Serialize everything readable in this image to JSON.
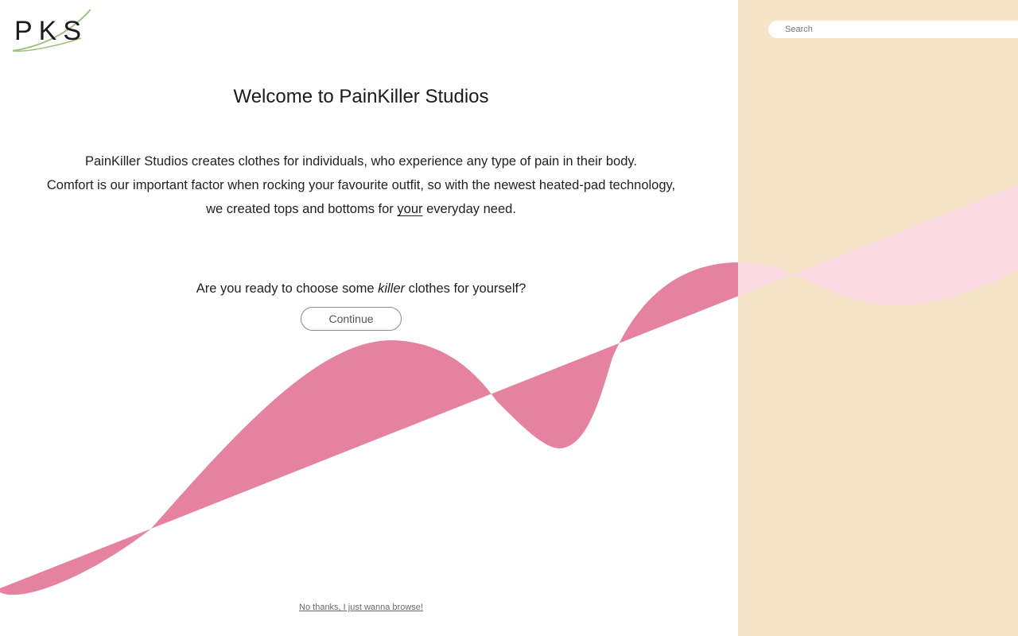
{
  "brand": {
    "logo_text": "PKS"
  },
  "search": {
    "placeholder": "Search",
    "value": ""
  },
  "welcome": {
    "title": "Welcome to PainKiller Studios",
    "line1": "PainKiller Studios creates clothes for individuals, who experience any type of pain in their body.",
    "line2": "Comfort is our important factor when rocking your favourite outfit, so with the newest heated-pad technology,",
    "line3_before": "we created tops and bottoms for ",
    "line3_emphasis": "your",
    "line3_after": " everyday need."
  },
  "prompt": {
    "before": "Are you ready to choose some ",
    "emphasis": "killer",
    "after": " clothes for yourself?"
  },
  "actions": {
    "continue_label": "Continue",
    "browse_label": "No thanks, I just wanna browse!"
  },
  "colors": {
    "right_panel": "#f7e5c9",
    "wave_main": "#e5829f",
    "wave_light": "#fddce6"
  }
}
